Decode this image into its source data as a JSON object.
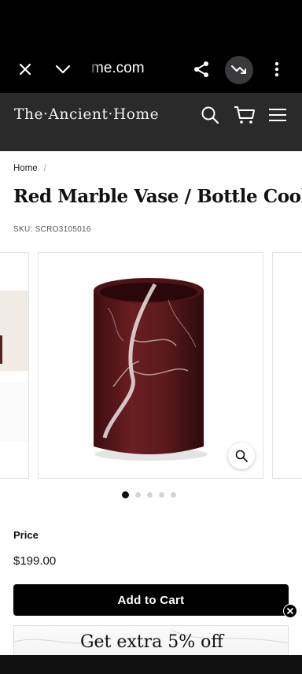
{
  "browser": {
    "url": "me.com",
    "icons": [
      "close-icon",
      "chevron-down-icon",
      "share-icon",
      "trending-down-icon",
      "more-vert-icon"
    ]
  },
  "header": {
    "logo": "The·Ancient·Home",
    "icons": [
      "search-icon",
      "cart-icon",
      "menu-icon"
    ]
  },
  "breadcrumb": {
    "home": "Home",
    "separator": "/"
  },
  "product": {
    "title": "Red Marble Vase / Bottle Cooler",
    "sku": "SKU: SCRO3105016",
    "price_label": "Price",
    "price": "$199.00",
    "add_to_cart": "Add to Cart",
    "gallery": {
      "image_count": 5,
      "active_index": 0,
      "zoom_icon": "zoom-icon"
    }
  },
  "promo": {
    "text": "Get extra 5% off",
    "close_icon": "close-circle-icon"
  },
  "colors": {
    "marble": "#5a1a1c",
    "header_bg": "#2a2a2a",
    "button_bg": "#000000"
  }
}
